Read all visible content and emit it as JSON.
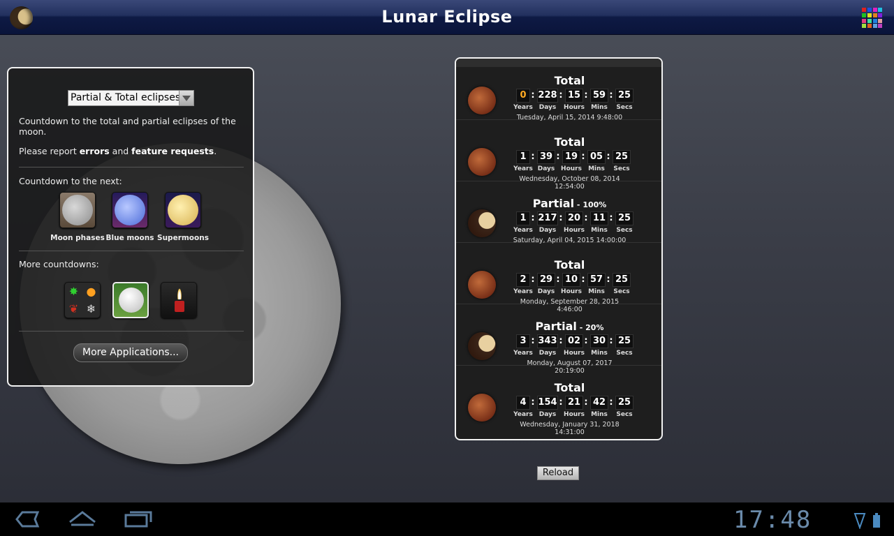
{
  "app": {
    "title": "Lunar Eclipse"
  },
  "panel": {
    "select_value": "Partial & Total eclipses",
    "description": "Countdown to the total and partial eclipses of the moon.",
    "report_prefix": "Please report ",
    "report_errors": "errors",
    "report_and": " and ",
    "report_features": "feature requests",
    "report_suffix": ".",
    "countdown_label": "Countdown to the next:",
    "countdown_items": [
      {
        "label": "Moon phases",
        "icon": "moon-phases-icon"
      },
      {
        "label": "Blue moons",
        "icon": "blue-moon-icon"
      },
      {
        "label": "Supermoons",
        "icon": "supermoon-icon"
      }
    ],
    "more_label": "More countdowns:",
    "more_items": [
      {
        "icon": "seasons-icon"
      },
      {
        "icon": "golf-ball-icon"
      },
      {
        "icon": "candle-icon"
      }
    ],
    "more_apps_label": "More Applications..."
  },
  "units": {
    "years": "Years",
    "days": "Days",
    "hours": "Hours",
    "mins": "Mins",
    "secs": "Secs"
  },
  "eclipses": [
    {
      "type": "Total",
      "percent": "",
      "kind": "total",
      "years": "0",
      "days": "228",
      "hours": "15",
      "mins": "59",
      "secs": "25",
      "date": "Tuesday, April 15, 2014  9:48:00"
    },
    {
      "type": "Total",
      "percent": "",
      "kind": "total",
      "years": "1",
      "days": "39",
      "hours": "19",
      "mins": "05",
      "secs": "25",
      "date": "Wednesday, October 08, 2014  12:54:00"
    },
    {
      "type": "Partial",
      "percent": " - 100%",
      "kind": "partial",
      "years": "1",
      "days": "217",
      "hours": "20",
      "mins": "11",
      "secs": "25",
      "date": "Saturday, April 04, 2015  14:00:00"
    },
    {
      "type": "Total",
      "percent": "",
      "kind": "total",
      "years": "2",
      "days": "29",
      "hours": "10",
      "mins": "57",
      "secs": "25",
      "date": "Monday, September 28, 2015  4:46:00"
    },
    {
      "type": "Partial",
      "percent": " - 20%",
      "kind": "partial",
      "years": "3",
      "days": "343",
      "hours": "02",
      "mins": "30",
      "secs": "25",
      "date": "Monday, August 07, 2017  20:19:00"
    },
    {
      "type": "Total",
      "percent": "",
      "kind": "total",
      "years": "4",
      "days": "154",
      "hours": "21",
      "mins": "42",
      "secs": "25",
      "date": "Wednesday, January 31, 2018  14:31:00"
    }
  ],
  "reload_label": "Reload",
  "system": {
    "clock": "17:48"
  },
  "colors": {
    "accent_orange": "#ffaa22",
    "title_bar": "#0e1a44"
  }
}
